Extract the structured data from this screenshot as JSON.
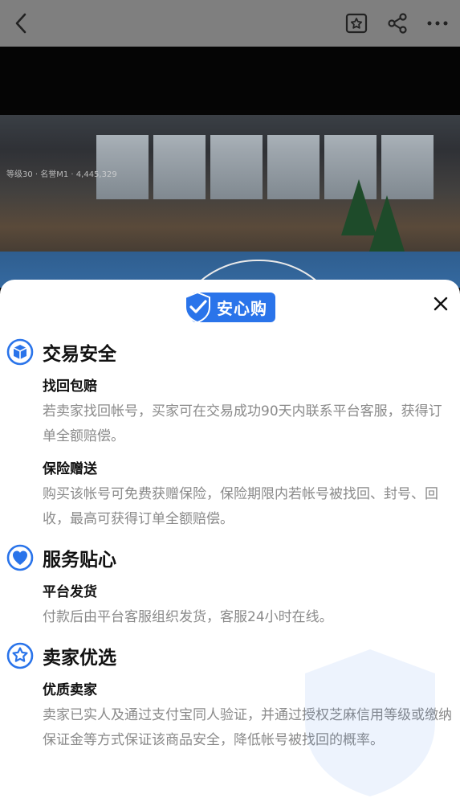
{
  "topbar": {
    "icons": [
      "back-icon",
      "favorite-star-icon",
      "share-icon",
      "more-icon"
    ]
  },
  "media": {
    "hud_text": "等级30  ·  名誉M1  ·  4,445,329"
  },
  "sheet": {
    "badge_label": "安心购",
    "sections": [
      {
        "title": "交易安全",
        "icon": "cube-shield-icon",
        "items": [
          {
            "title": "找回包赔",
            "desc": "若卖家找回帐号，买家可在交易成功90天内联系平台客服，获得订单全额赔偿。"
          },
          {
            "title": "保险赠送",
            "desc": "购买该帐号可免费获赠保险，保险期限内若帐号被找回、封号、回收，最高可获得订单全额赔偿。"
          }
        ]
      },
      {
        "title": "服务贴心",
        "icon": "heart-icon",
        "items": [
          {
            "title": "平台发货",
            "desc": "付款后由平台客服组织发货，客服24小时在线。"
          }
        ]
      },
      {
        "title": "卖家优选",
        "icon": "star-badge-icon",
        "items": [
          {
            "title": "优质卖家",
            "desc": "卖家已实人及通过支付宝同人验证，并通过授权芝麻信用等级或缴纳保证金等方式保证该商品安全，降低帐号被找回的概率。"
          }
        ]
      }
    ]
  },
  "colors": {
    "accent": "#2a74ea",
    "topbar_bg": "#7f7f7f",
    "desc_text": "#8a8a8a"
  }
}
